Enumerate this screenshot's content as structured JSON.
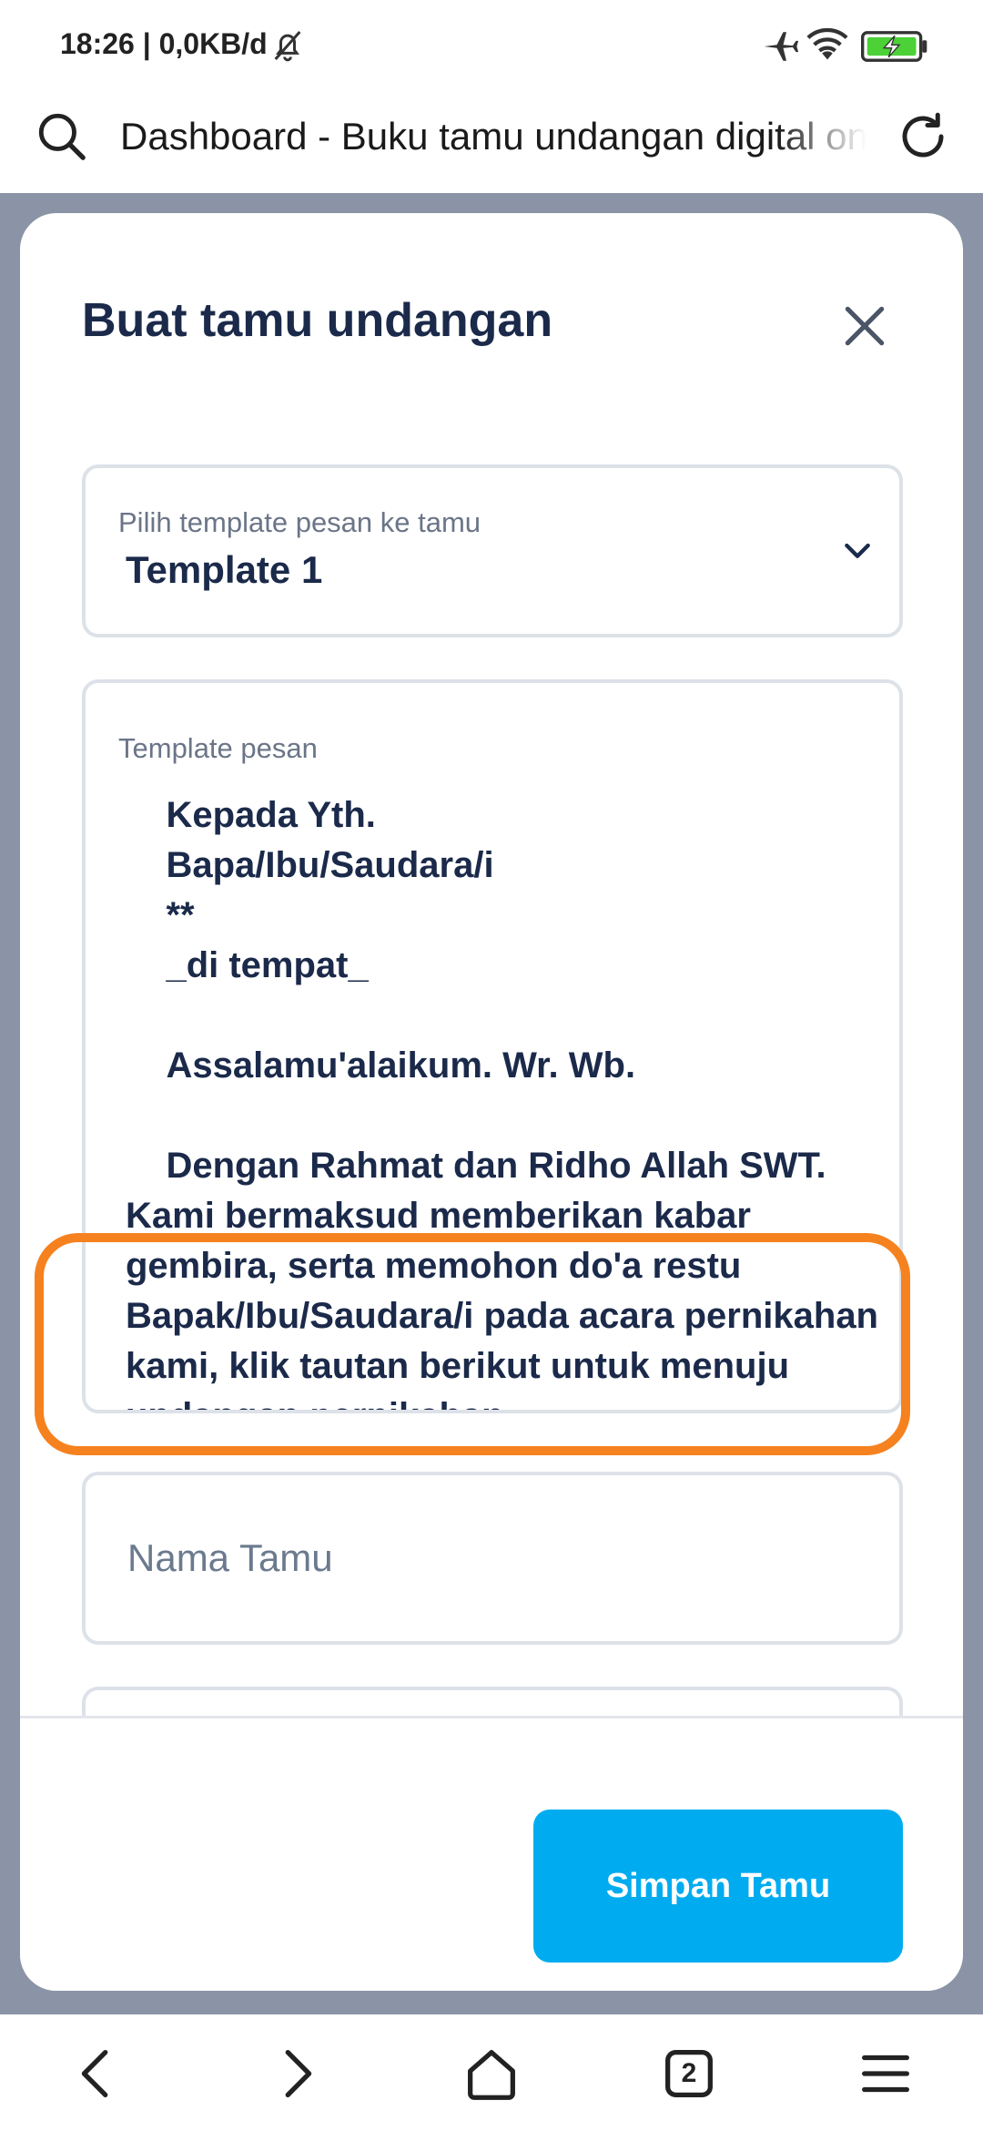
{
  "status_bar": {
    "time": "18:26 | 0,0KB/d"
  },
  "address_bar": {
    "title": "Dashboard - Buku tamu undangan digital online"
  },
  "modal": {
    "title": "Buat tamu undangan",
    "template_select": {
      "label": "Pilih template pesan ke tamu",
      "value": "Template 1"
    },
    "message_template": {
      "label": "Template pesan",
      "text": "    Kepada Yth.\n    Bapa/Ibu/Saudara/i\n    **\n    _di tempat_\n\n    Assalamu'alaikum. Wr. Wb.\n\n    Dengan Rahmat dan Ridho Allah SWT. Kami bermaksud memberikan kabar gembira, serta memohon do'a restu Bapak/Ibu/Saudara/i pada acara pernikahan kami, klik tautan berikut untuk menuju undangan pernikahan"
    },
    "guest_name": {
      "placeholder": "Nama Tamu",
      "value": ""
    },
    "save_button": "Simpan Tamu"
  },
  "nav_bar": {
    "tab_count": "2"
  },
  "colors": {
    "accent": "#00acef",
    "highlight": "#f5821f",
    "backdrop": "#8a94a6",
    "text": "#1b2a4a"
  }
}
